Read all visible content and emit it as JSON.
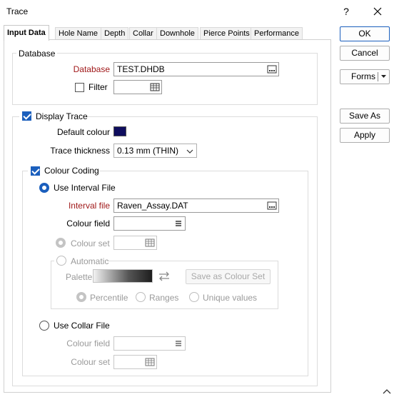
{
  "window": {
    "title": "Trace",
    "help_label": "?",
    "close_label": "✕"
  },
  "tabs": [
    {
      "label": "Input Data"
    },
    {
      "label": "Hole Name"
    },
    {
      "label": "Depth"
    },
    {
      "label": "Collar"
    },
    {
      "label": "Downhole"
    },
    {
      "label": "Pierce Points"
    },
    {
      "label": "Performance"
    }
  ],
  "database_group": {
    "legend": "Database",
    "database_label": "Database",
    "database_value": "TEST.DHDB",
    "filter_label": "Filter",
    "filter_checked": false,
    "filter_value": ""
  },
  "display_trace": {
    "label": "Display Trace",
    "checked": true,
    "default_colour_label": "Default colour",
    "default_colour": "#0f0d5e",
    "thickness_label": "Trace thickness",
    "thickness_value": "0.13 mm (THIN)"
  },
  "colour_coding": {
    "label": "Colour Coding",
    "checked": true,
    "use_interval_label": "Use Interval File",
    "interval_file_label": "Interval file",
    "interval_file_value": "Raven_Assay.DAT",
    "colour_field_label": "Colour field",
    "colour_field_value": "",
    "colour_set_label": "Colour set",
    "automatic_label": "Automatic",
    "palette_label": "Palette",
    "save_colour_set_label": "Save as Colour Set",
    "percentile_label": "Percentile",
    "ranges_label": "Ranges",
    "unique_values_label": "Unique values",
    "use_collar_label": "Use Collar File",
    "collar_colour_field_label": "Colour field",
    "collar_colour_set_label": "Colour set"
  },
  "buttons": {
    "ok": "OK",
    "cancel": "Cancel",
    "forms": "Forms",
    "save_as": "Save As",
    "apply": "Apply"
  },
  "accent_color": "#1b5fbd"
}
